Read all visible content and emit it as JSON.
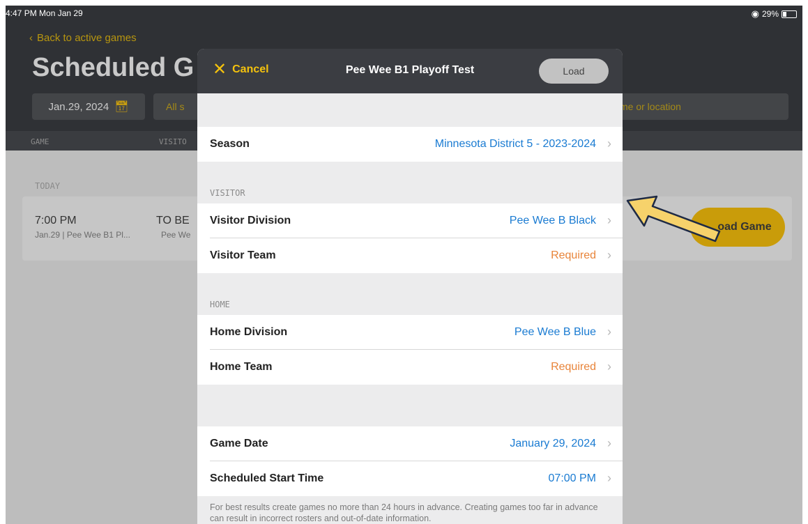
{
  "status_bar": {
    "time": "4:47 PM  Mon Jan 29",
    "battery": "29%",
    "battery_level": 0.29
  },
  "background_app": {
    "back_link": "Back to active games",
    "title": "Scheduled G",
    "date_filter": "Jan.29, 2024",
    "status_filter": "All s",
    "search_placeholder": "me or location",
    "columns": [
      "GAME",
      "VISITO"
    ],
    "section": "TODAY",
    "game": {
      "time": "7:00 PM",
      "subtitle": "Jan.29 | Pee Wee B1 Pl...",
      "team": "TO BE",
      "team_sub": "Pee We",
      "action": "Load Game",
      "action_visible": "oad Game"
    }
  },
  "modal": {
    "cancel_label": "Cancel",
    "title": "Pee Wee B1 Playoff Test",
    "load_label": "Load",
    "season_label": "Season",
    "season_value": "Minnesota District 5 - 2023-2024",
    "visitor_section": "VISITOR",
    "visitor_division_label": "Visitor Division",
    "visitor_division_value": "Pee Wee B Black",
    "visitor_team_label": "Visitor Team",
    "visitor_team_value": "Required",
    "home_section": "HOME",
    "home_division_label": "Home Division",
    "home_division_value": "Pee Wee B Blue",
    "home_team_label": "Home Team",
    "home_team_value": "Required",
    "game_date_label": "Game Date",
    "game_date_value": "January 29, 2024",
    "start_time_label": "Scheduled Start Time",
    "start_time_value": "07:00 PM",
    "footnote": "For best results create games no more than 24 hours in advance. Creating games too far in advance can result in incorrect rosters and out-of-date information."
  },
  "colors": {
    "accent": "#f4c20d",
    "link_blue": "#1a7bd2",
    "required_orange": "#e8843a",
    "header_dark": "#3b3d42",
    "annotation_arrow": "#f6d26b"
  },
  "icons": {
    "back": "chevron-left-icon",
    "calendar": "calendar-icon",
    "cancel": "close-icon",
    "row_chevron": "chevron-right-icon",
    "wifi": "wifi-icon",
    "battery": "battery-icon"
  }
}
